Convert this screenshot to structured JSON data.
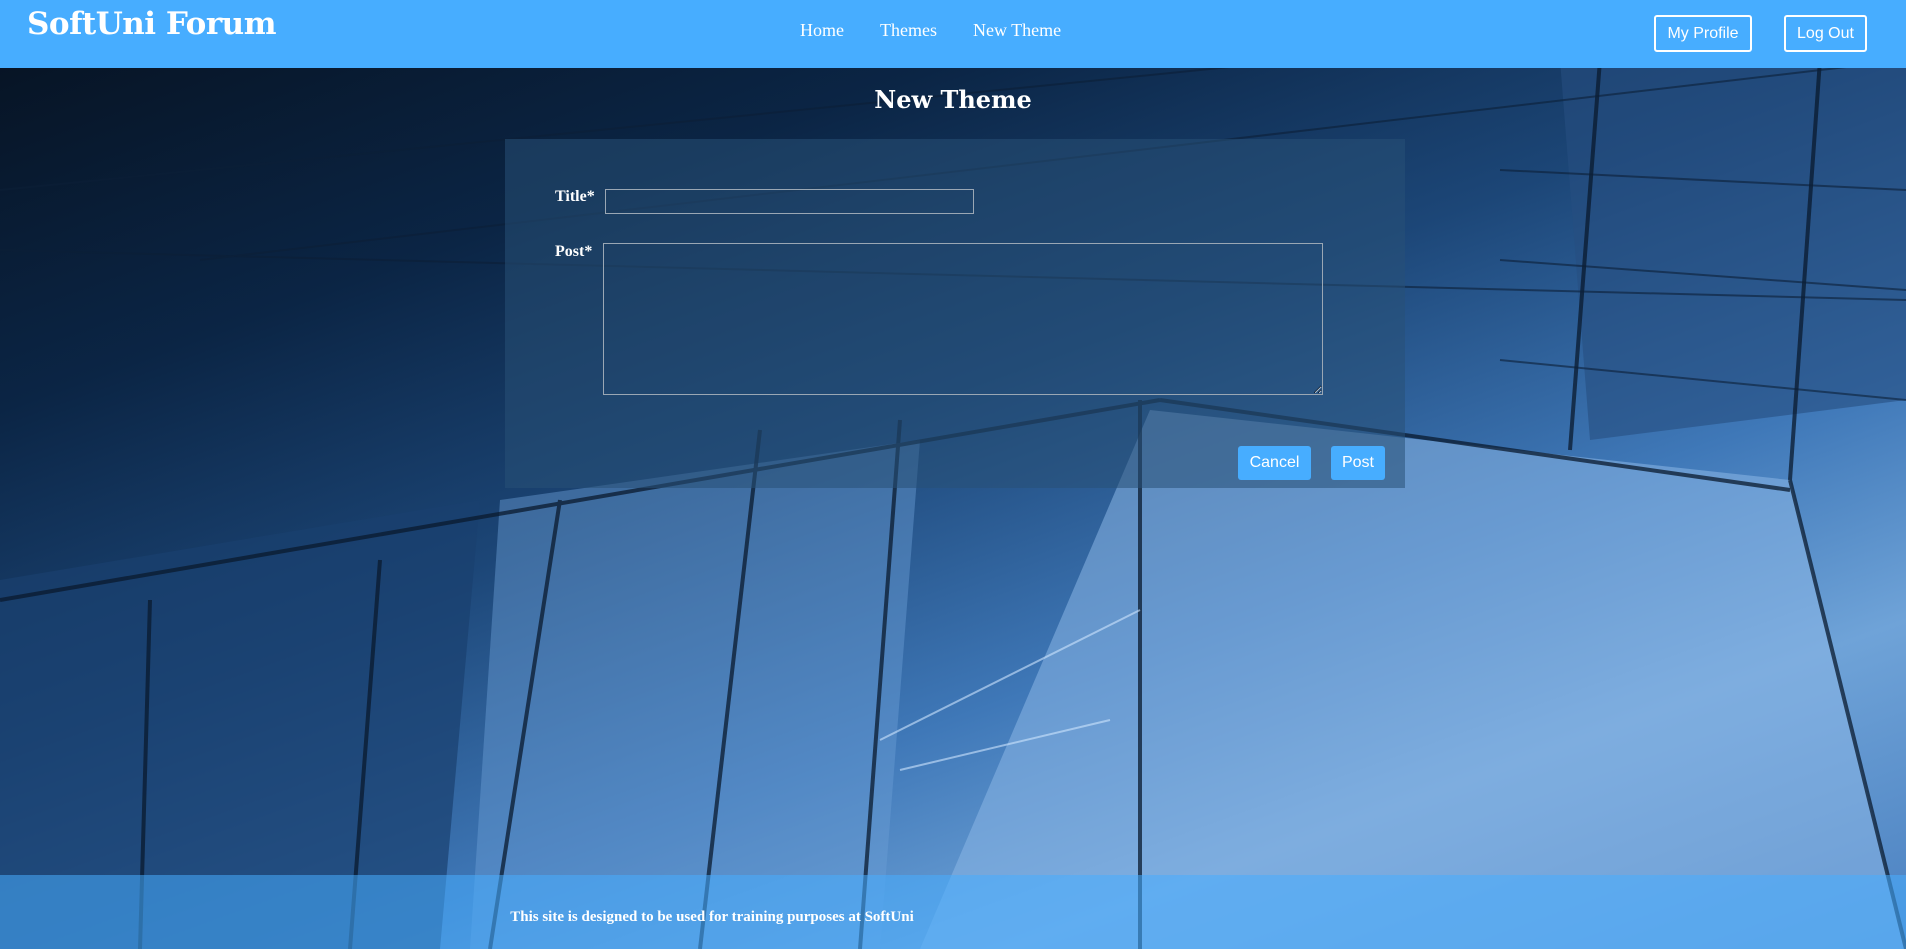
{
  "header": {
    "brand": "SoftUni Forum",
    "nav": [
      "Home",
      "Themes",
      "New Theme"
    ],
    "my_profile": "My Profile",
    "log_out": "Log Out"
  },
  "page": {
    "title": "New Theme",
    "form": {
      "title_label": "Title*",
      "title_value": "",
      "post_label": "Post*",
      "post_value": "",
      "cancel_label": "Cancel",
      "post_button_label": "Post"
    }
  },
  "footer": {
    "text": "This site is designed to be used for training purposes at SoftUni"
  },
  "colors": {
    "accent": "#47adff"
  }
}
